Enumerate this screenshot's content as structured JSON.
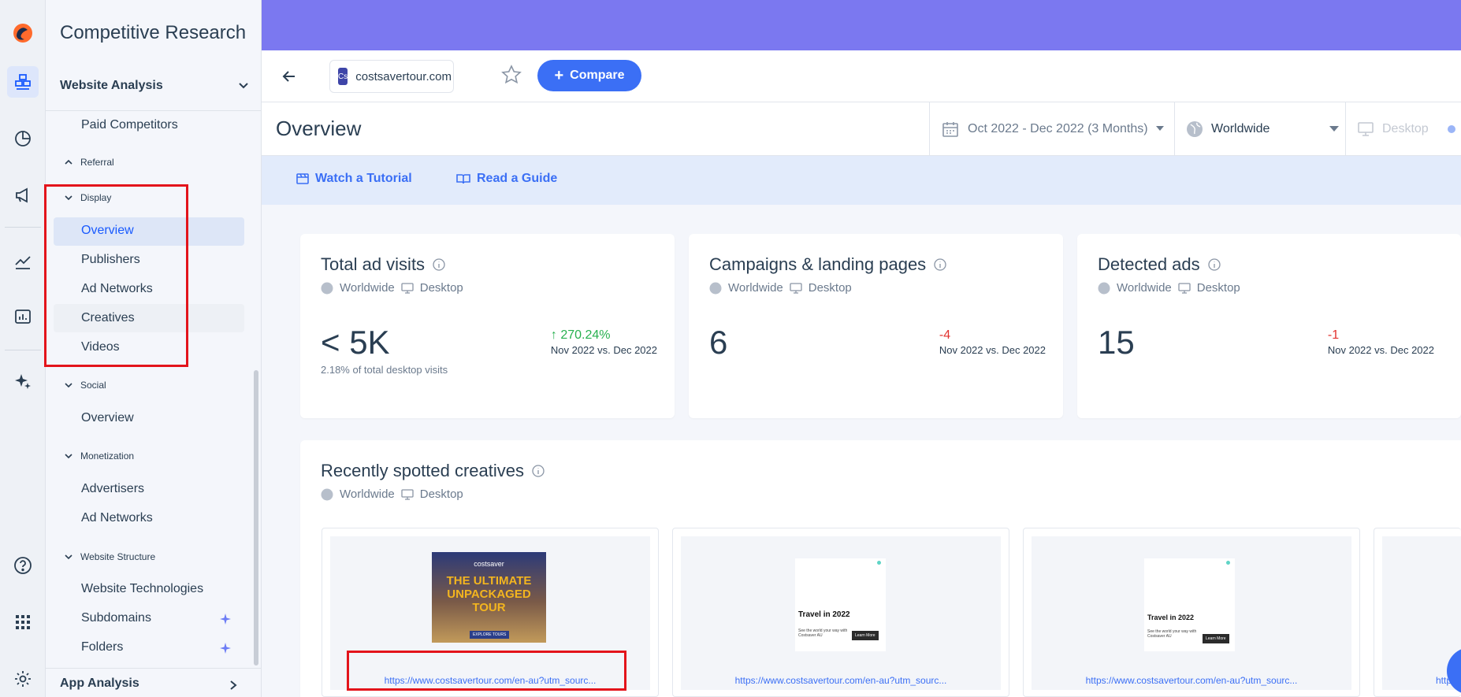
{
  "app": {
    "title": "Competitive Research"
  },
  "sidebar": {
    "section": "Website Analysis",
    "items": [
      {
        "label": "Paid Competitors"
      }
    ],
    "groups": {
      "referral": "Referral",
      "display": "Display",
      "social": "Social",
      "monetization": "Monetization",
      "structure": "Website Structure"
    },
    "display_items": [
      "Overview",
      "Publishers",
      "Ad Networks",
      "Creatives",
      "Videos"
    ],
    "social_items": [
      "Overview"
    ],
    "monetization_items": [
      "Advertisers",
      "Ad Networks"
    ],
    "structure_items": [
      "Website Technologies",
      "Subdomains",
      "Folders"
    ],
    "bottom_section": "App Analysis"
  },
  "header": {
    "site": "costsavertour.com",
    "favicon_text": "Cs",
    "compare_label": "Compare"
  },
  "page": {
    "title": "Overview",
    "date_range": "Oct 2022 - Dec 2022 (3 Months)",
    "country": "Worldwide",
    "device": "Desktop"
  },
  "tutorial": {
    "watch": "Watch a Tutorial",
    "guide": "Read a Guide"
  },
  "cards": {
    "ad_visits": {
      "title": "Total ad visits",
      "region": "Worldwide",
      "device": "Desktop",
      "value": "< 5K",
      "note": "2.18% of total desktop visits",
      "delta": "270.24%",
      "compare": "Nov 2022 vs. Dec 2022"
    },
    "campaigns": {
      "title": "Campaigns & landing pages",
      "region": "Worldwide",
      "device": "Desktop",
      "value": "6",
      "delta": "-4",
      "compare": "Nov 2022 vs. Dec 2022"
    },
    "detected": {
      "title": "Detected ads",
      "region": "Worldwide",
      "device": "Desktop",
      "value": "15",
      "delta": "-1",
      "compare": "Nov 2022 vs. Dec 2022"
    }
  },
  "creatives": {
    "title": "Recently spotted creatives",
    "region": "Worldwide",
    "device": "Desktop",
    "urls": [
      "https://www.costsavertour.com/en-au?utm_sourc...",
      "https://www.costsavertour.com/en-au?utm_sourc...",
      "https://www.costsavertour.com/en-au?utm_sourc...",
      "http"
    ],
    "ad1": {
      "brand": "costsaver",
      "headline": "THE ULTIMATE UNPACKAGED TOUR",
      "cta": "EXPLORE TOURS"
    },
    "ad2": {
      "headline": "Travel in 2022",
      "body": "See the world your way with Costsaver AU",
      "cta": "Learn More"
    },
    "ad3": {
      "headline": "Travel in 2022",
      "body": "See the world your way with Costsaver AU",
      "cta": "Learn More"
    }
  },
  "colors": {
    "accent": "#3b6ff5",
    "topbar": "#7b78f0",
    "positive": "#27b04f",
    "negative": "#e2322f",
    "annotation": "#e3141b"
  }
}
